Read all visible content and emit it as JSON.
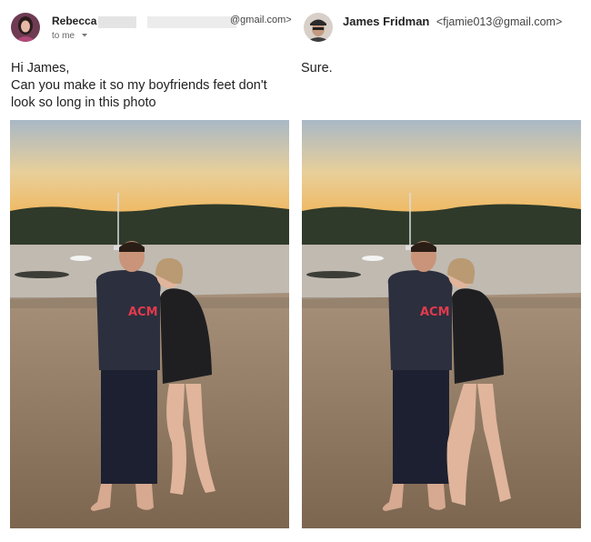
{
  "left_email": {
    "sender_name": "Rebecca",
    "sender_email_suffix": "@gmail.com>",
    "to_label": "to me",
    "body_lines": [
      "Hi James,",
      "Can you make it so my boyfriends feet don't",
      "look so long in this photo"
    ]
  },
  "right_email": {
    "sender_name": "James Fridman",
    "sender_email": "<fjamie013@gmail.com>",
    "body_lines": [
      "Sure."
    ]
  },
  "photos": {
    "left": {
      "shirt_text": "ACM"
    },
    "right": {
      "shirt_text": "ACM"
    }
  },
  "icons": [
    "avatar-rebecca",
    "avatar-james",
    "chevron-down-icon"
  ],
  "colors": {
    "link_gray": "#555555",
    "accent_shirt": "#e23a4d"
  }
}
